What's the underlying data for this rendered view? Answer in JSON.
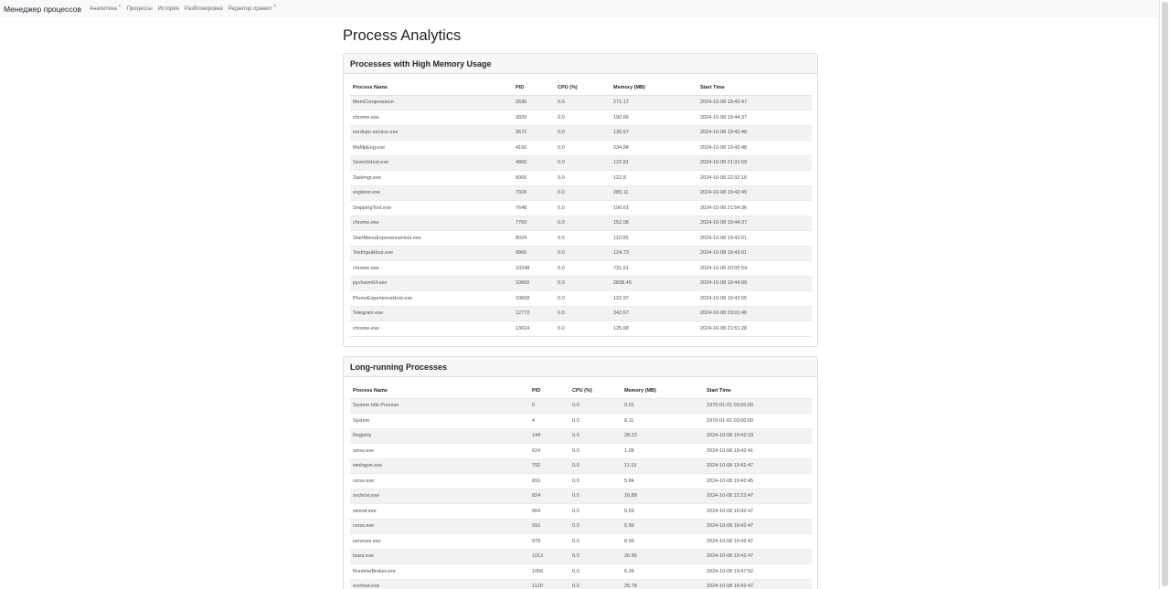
{
  "navbar": {
    "brand": "Менеджер процессов",
    "items": [
      {
        "label": "Аналитика",
        "caret": "˄"
      },
      {
        "label": "Процессы"
      },
      {
        "label": "История"
      },
      {
        "label": "Разблокировка"
      },
      {
        "label": "Редактор правил",
        "caret": "˄"
      }
    ]
  },
  "page": {
    "title": "Process Analytics"
  },
  "memory_card": {
    "title": "Processes with High Memory Usage",
    "columns": [
      "Process Name",
      "PID",
      "CPU (%)",
      "Memory (MB)",
      "Start Time"
    ],
    "rows": [
      [
        "MemCompression",
        "2536",
        "0.0",
        "271.17",
        "2024-10-08 19:42:47"
      ],
      [
        "chrome.exe",
        "3020",
        "0.0",
        "190.66",
        "2024-10-08 19:44:37"
      ],
      [
        "nordvpn-service.exe",
        "3672",
        "0.0",
        "130.67",
        "2024-10-08 19:42:48"
      ],
      [
        "MsMpEng.exe",
        "4160",
        "0.0",
        "234.84",
        "2024-10-08 19:42:48"
      ],
      [
        "SearchHost.exe",
        "4860",
        "0.0",
        "122.81",
        "2024-10-08 21:31:59"
      ],
      [
        "Taskmgr.exe",
        "5000",
        "0.0",
        "122.8",
        "2024-10-08 22:32:16"
      ],
      [
        "explorer.exe",
        "7028",
        "0.0",
        "285.11",
        "2024-10-08 19:42:49"
      ],
      [
        "SnippingTool.exe",
        "7648",
        "0.0",
        "190.61",
        "2024-10-08 21:54:36"
      ],
      [
        "chrome.exe",
        "7700",
        "0.0",
        "152.08",
        "2024-10-08 19:44:37"
      ],
      [
        "StartMenuExperienceHost.exe",
        "8024",
        "0.0",
        "110.55",
        "2024-10-08 19:42:51"
      ],
      [
        "TextInputHost.exe",
        "9960",
        "0.0",
        "124.73",
        "2024-10-08 19:43:01"
      ],
      [
        "chrome.exe",
        "10248",
        "0.0",
        "731.61",
        "2024-10-08 20:05:54"
      ],
      [
        "pycharm64.exe",
        "10600",
        "0.0",
        "2838.45",
        "2024-10-08 19:44:09"
      ],
      [
        "PhoneExperienceHost.exe",
        "10608",
        "0.0",
        "122.97",
        "2024-10-08 19:42:55"
      ],
      [
        "Telegram.exe",
        "12772",
        "0.0",
        "342.67",
        "2024-10-08 23:01:46"
      ],
      [
        "chrome.exe",
        "13024",
        "0.0",
        "125.68",
        "2024-10-08 21:51:28"
      ]
    ]
  },
  "long_card": {
    "title": "Long-running Processes",
    "columns": [
      "Process Name",
      "PID",
      "CPU (%)",
      "Memory (MB)",
      "Start Time"
    ],
    "rows": [
      [
        "System Idle Process",
        "0",
        "0.0",
        "0.01",
        "1970-01-01 03:00:00"
      ],
      [
        "System",
        "4",
        "0.0",
        "8.11",
        "1970-01-01 03:00:00"
      ],
      [
        "Registry",
        "144",
        "0.0",
        "28.22",
        "2024-10-08 19:42:33"
      ],
      [
        "smss.exe",
        "624",
        "0.0",
        "1.05",
        "2024-10-08 19:42:41"
      ],
      [
        "winlogon.exe",
        "792",
        "0.0",
        "11.19",
        "2024-10-08 19:42:47"
      ],
      [
        "csrss.exe",
        "816",
        "0.0",
        "5.84",
        "2024-10-08 19:42:45"
      ],
      [
        "svchost.exe",
        "824",
        "0.0",
        "16.88",
        "2024-10-08 22:22:47"
      ],
      [
        "wininit.exe",
        "904",
        "0.0",
        "6.59",
        "2024-10-08 19:42:47"
      ],
      [
        "csrss.exe",
        "916",
        "0.0",
        "5.99",
        "2024-10-08 19:42:47"
      ],
      [
        "services.exe",
        "978",
        "0.0",
        "8.99",
        "2024-10-08 19:42:47"
      ],
      [
        "lsass.exe",
        "1012",
        "0.0",
        "26.56",
        "2024-10-08 19:42:47"
      ],
      [
        "RuntimeBroker.exe",
        "1056",
        "0.0",
        "6.26",
        "2024-10-08 19:47:52"
      ],
      [
        "svchost.exe",
        "1120",
        "0.0",
        "25.78",
        "2024-10-08 19:42:47"
      ]
    ]
  }
}
